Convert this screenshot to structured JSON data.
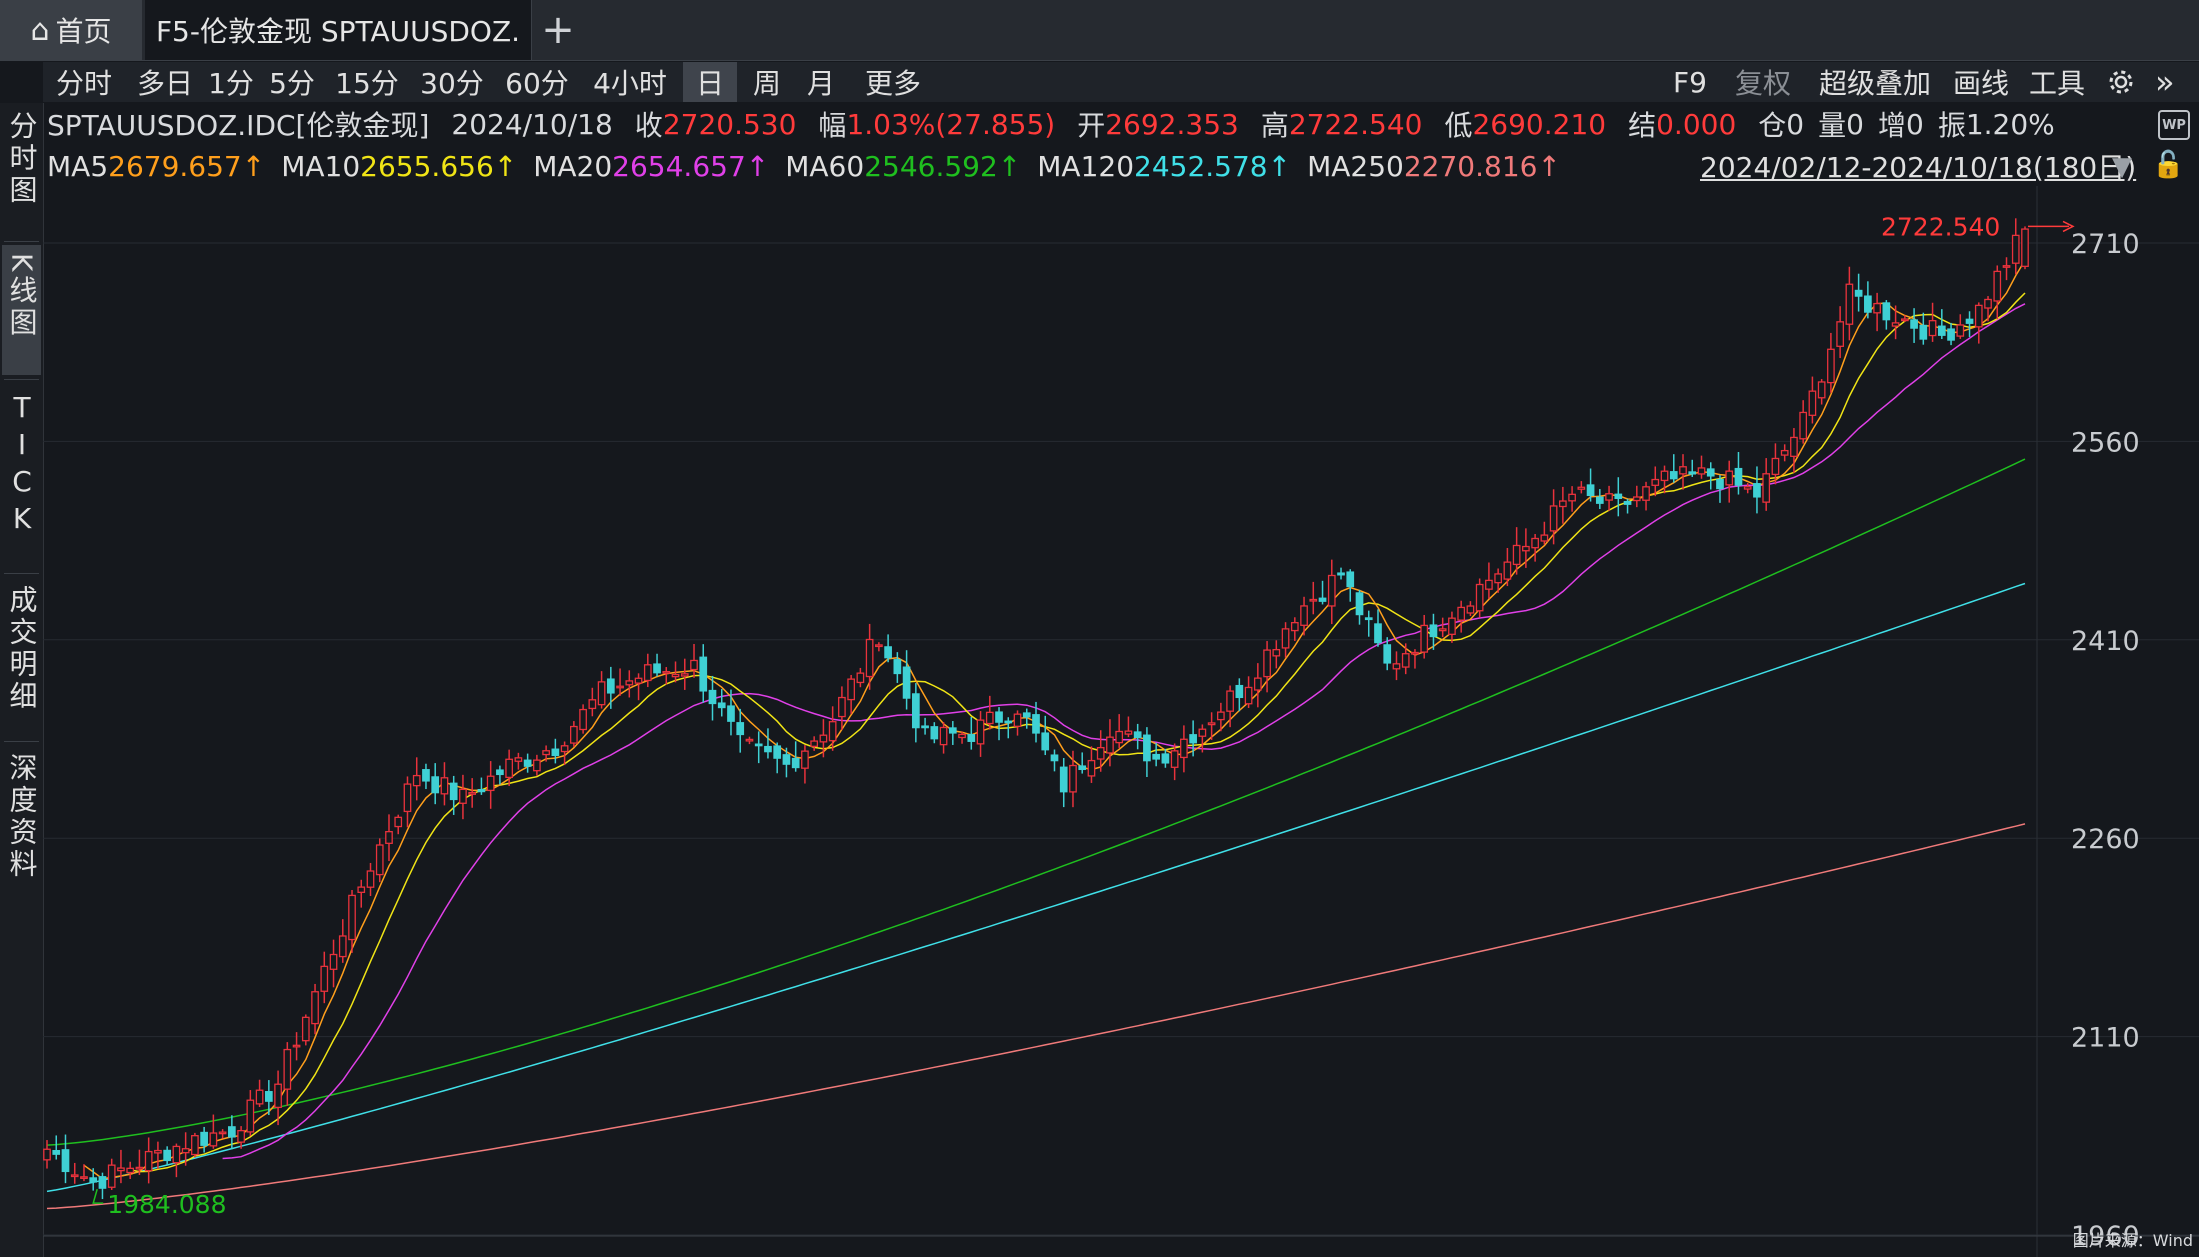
{
  "tabs": {
    "home_label": "首页",
    "active_label": "F5-伦敦金现 SPTAUUSDOZ.",
    "add_label": "+"
  },
  "periods": [
    "分时",
    "多日",
    "1分",
    "5分",
    "15分",
    "30分",
    "60分",
    "4小时",
    "日",
    "周",
    "月",
    "更多"
  ],
  "selected_period": "日",
  "tools": {
    "f9": "F9",
    "restore": "复权",
    "overlay": "超级叠加",
    "draw": "画线",
    "tools": "工具",
    "expand": "»"
  },
  "side_tabs": [
    "分时图",
    "K线图",
    "TICK",
    "成交明细",
    "深度资料"
  ],
  "selected_side_tab": "K线图",
  "quote": {
    "name": "SPTAUUSDOZ.IDC[伦敦金现]",
    "date": "2024/10/18",
    "close_label": "收",
    "close": "2720.530",
    "change_label": "幅",
    "change": "1.03%(27.855)",
    "open_label": "开",
    "open": "2692.353",
    "high_label": "高",
    "high": "2722.540",
    "low_label": "低",
    "low": "2690.210",
    "settle_label": "结",
    "settle": "0.000",
    "oi_label": "仓",
    "oi": "0",
    "vol_label": "量",
    "vol": "0",
    "inc_label": "增",
    "inc": "0",
    "amp_label": "振",
    "amp": "1.20%"
  },
  "ma_legend": [
    {
      "label": "MA5",
      "value": "2679.657↑",
      "color": "#ff9f1c"
    },
    {
      "label": "MA10",
      "value": "2655.656↑",
      "color": "#f0e416"
    },
    {
      "label": "MA20",
      "value": "2654.657↑",
      "color": "#e040e8"
    },
    {
      "label": "MA60",
      "value": "2546.592↑",
      "color": "#1fbf1f"
    },
    {
      "label": "MA120",
      "value": "2452.578↑",
      "color": "#40e0e8"
    },
    {
      "label": "MA250",
      "value": "2270.816↑",
      "color": "#f07a7a"
    }
  ],
  "date_range": "2024/02/12-2024/10/18(180日)",
  "source_note": "图片来源：Wind",
  "colors": {
    "up": "#e8323c",
    "down": "#3fd0d4",
    "bg": "#15181d"
  },
  "chart_data": {
    "type": "line",
    "ylim": [
      1960,
      2740
    ],
    "yticks": [
      1960,
      2110,
      2260,
      2410,
      2560,
      2710
    ],
    "high_marker": "2722.540",
    "low_marker": "1984.088",
    "close_anchors": [
      [
        0,
        2025
      ],
      [
        5,
        2000
      ],
      [
        10,
        2015
      ],
      [
        15,
        2030
      ],
      [
        20,
        2040
      ],
      [
        25,
        2075
      ],
      [
        30,
        2160
      ],
      [
        35,
        2240
      ],
      [
        40,
        2310
      ],
      [
        45,
        2290
      ],
      [
        50,
        2315
      ],
      [
        55,
        2330
      ],
      [
        60,
        2370
      ],
      [
        65,
        2385
      ],
      [
        70,
        2390
      ],
      [
        75,
        2330
      ],
      [
        80,
        2315
      ],
      [
        85,
        2350
      ],
      [
        90,
        2415
      ],
      [
        95,
        2335
      ],
      [
        100,
        2340
      ],
      [
        105,
        2360
      ],
      [
        110,
        2300
      ],
      [
        115,
        2345
      ],
      [
        120,
        2320
      ],
      [
        125,
        2345
      ],
      [
        130,
        2380
      ],
      [
        135,
        2430
      ],
      [
        140,
        2460
      ],
      [
        145,
        2390
      ],
      [
        150,
        2420
      ],
      [
        155,
        2450
      ],
      [
        160,
        2480
      ],
      [
        165,
        2520
      ],
      [
        170,
        2510
      ],
      [
        175,
        2530
      ],
      [
        180,
        2535
      ],
      [
        185,
        2520
      ],
      [
        190,
        2575
      ],
      [
        195,
        2670
      ],
      [
        200,
        2655
      ],
      [
        205,
        2640
      ],
      [
        209,
        2660
      ],
      [
        214,
        2720.53
      ]
    ],
    "ma_end_values": {
      "MA5": 2679.657,
      "MA10": 2655.656,
      "MA20": 2654.657,
      "MA60": 2546.592,
      "MA120": 2452.578,
      "MA250": 2270.816
    }
  }
}
